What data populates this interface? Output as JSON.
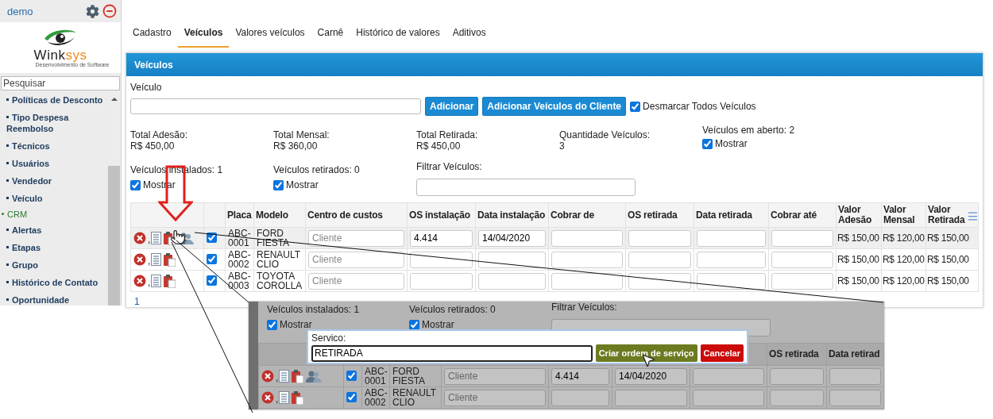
{
  "sidebar": {
    "user": "demo",
    "logo": {
      "parts": [
        "Wink",
        "sys"
      ],
      "tagline": "Desenvolvimento de Software"
    },
    "search": {
      "placeholder": "Pesquisar"
    },
    "items": [
      {
        "label": "Políticas de Desconto",
        "kind": "item"
      },
      {
        "label": "Tipo Despesa Reembolso",
        "kind": "item"
      },
      {
        "label": "Técnicos",
        "kind": "item"
      },
      {
        "label": "Usuários",
        "kind": "item"
      },
      {
        "label": "Vendedor",
        "kind": "item"
      },
      {
        "label": "Veículo",
        "kind": "item"
      },
      {
        "label": "CRM",
        "kind": "section"
      },
      {
        "label": "Alertas",
        "kind": "item"
      },
      {
        "label": "Etapas",
        "kind": "item"
      },
      {
        "label": "Grupo",
        "kind": "item"
      },
      {
        "label": "Histórico de Contato",
        "kind": "item"
      },
      {
        "label": "Oportunidade",
        "kind": "item"
      }
    ]
  },
  "tabs": [
    {
      "label": "Cadastro",
      "selected": false
    },
    {
      "label": "Veículos",
      "selected": true
    },
    {
      "label": "Valores veículos",
      "selected": false
    },
    {
      "label": "Carnê",
      "selected": false
    },
    {
      "label": "Histórico de valores",
      "selected": false
    },
    {
      "label": "Aditivos",
      "selected": false
    }
  ],
  "panel": {
    "title": "Veículos",
    "vehicle_label": "Veículo",
    "buttons": [
      "Adicionar",
      "Adicionar Veículos do Cliente"
    ],
    "uncheck_all": {
      "label": "Desmarcar Todos Veículos",
      "checked": true
    },
    "totals": [
      {
        "label": "Total Adesão:",
        "value": "R$ 450,00"
      },
      {
        "label": "Total Mensal:",
        "value": "R$ 360,00"
      },
      {
        "label": "Total Retirada:",
        "value": "R$ 450,00"
      },
      {
        "label": "Quantidade Veículos:",
        "value": "3"
      }
    ],
    "open": {
      "label": "Veículos em aberto: 2",
      "show": {
        "label": "Mostrar",
        "checked": true
      }
    },
    "installed": {
      "label": "Veículos instalados: 1",
      "show": {
        "label": "Mostrar",
        "checked": true
      }
    },
    "retired": {
      "label": "Veículos retirados: 0",
      "show": {
        "label": "Mostrar",
        "checked": true
      }
    },
    "filter": {
      "label": "Filtrar Veículos:"
    },
    "table": {
      "columns": [
        "Placa",
        "Modelo",
        "Centro de custos",
        "OS instalação",
        "Data instalação",
        "Cobrar de",
        "OS retirada",
        "Data retirada",
        "Cobrar até",
        "Valor Adesão",
        "Valor Mensal",
        "Valor Retirada"
      ],
      "rows": [
        {
          "separator": ",",
          "client_icon": true,
          "checked": true,
          "highlighted": true,
          "plate": "ABC-0001",
          "model": "FORD FIESTA",
          "cost_center_placeholder": "Cliente",
          "os_install": "4.414",
          "install_date": "14/04/2020",
          "adesao": "R$ 150,00",
          "mensal": "R$ 120,00",
          "retirada": "R$ 150,00"
        },
        {
          "separator": ",",
          "client_icon": false,
          "checked": true,
          "highlighted": false,
          "plate": "ABC-0002",
          "model": "RENAULT CLIO",
          "cost_center_placeholder": "Cliente",
          "adesao": "R$ 150,00",
          "mensal": "R$ 120,00",
          "retirada": "R$ 150,00"
        },
        {
          "separator": ",",
          "client_icon": false,
          "checked": true,
          "highlighted": false,
          "plate": "ABC-0003",
          "model": "TOYOTA COROLLA",
          "cost_center_placeholder": "Cliente",
          "adesao": "R$ 150,00",
          "mensal": "R$ 120,00",
          "retirada": "R$ 150,00"
        }
      ]
    },
    "pages": [
      {
        "label": "1",
        "selected": true
      }
    ]
  },
  "callout": {
    "installed": {
      "label": "Veículos instalados: 1",
      "show": {
        "label": "Mostrar",
        "checked": true
      }
    },
    "retired": {
      "label": "Veículos retirados: 0",
      "show": {
        "label": "Mostrar",
        "checked": true
      }
    },
    "filter": {
      "label": "Filtrar Veículos:"
    },
    "columns": [
      "OS retirada",
      "Data retirad"
    ],
    "rows": [
      {
        "separator": ",",
        "client_icon": true,
        "checked": true,
        "plate": "ABC-0001",
        "model": "FORD FIESTA",
        "cost_center_placeholder": "Cliente",
        "os_install": "4.414",
        "install_date": "14/04/2020"
      },
      {
        "separator": ",",
        "client_icon": false,
        "checked": true,
        "plate": "ABC-0002",
        "model": "RENAULT CLIO",
        "cost_center_placeholder": "Cliente"
      }
    ],
    "dialog": {
      "label": "Servico:",
      "value": "RETIRADA",
      "buttons": [
        {
          "label": "Criar ordem de serviço",
          "kind": "confirm"
        },
        {
          "label": "Cancelar",
          "kind": "cancel"
        }
      ]
    }
  }
}
